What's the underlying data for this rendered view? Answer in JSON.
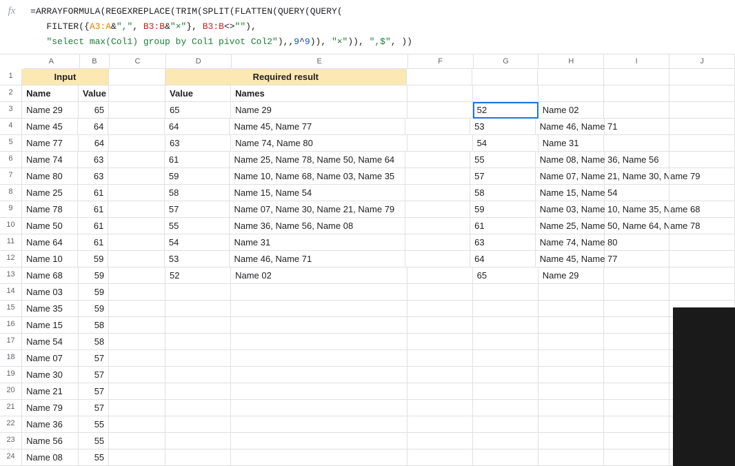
{
  "formula": {
    "line1_parts": [
      "=",
      "ARRAYFORMULA",
      "(",
      "REGEXREPLACE",
      "(",
      "TRIM",
      "(",
      "SPLIT",
      "(",
      "FLATTEN",
      "(",
      "QUERY",
      "(",
      "QUERY",
      "("
    ],
    "line2_indent": "   ",
    "line2_parts": [
      "FILTER",
      "({",
      "A3:A",
      "&",
      "\",\"",
      ", ",
      "B3:B",
      "&",
      "\"×\"",
      "}, ",
      "B3:B",
      "<>",
      "\"\"",
      "),"
    ],
    "line3_indent": "   ",
    "line3_parts": [
      "\"select max(Col1) group by Col1 pivot Col2\"",
      "),,",
      "9",
      "^",
      "9",
      ")), ",
      "\"×\"",
      ")), ",
      "\",$\"",
      ", ))"
    ]
  },
  "columns": [
    "A",
    "B",
    "C",
    "D",
    "E",
    "F",
    "G",
    "H",
    "I",
    "J"
  ],
  "headers": {
    "input_label": "Input",
    "result_label": "Required result",
    "name": "Name",
    "value": "Value",
    "names": "Names"
  },
  "input_data": [
    [
      "Name 29",
      "65"
    ],
    [
      "Name 45",
      "64"
    ],
    [
      "Name 77",
      "64"
    ],
    [
      "Name 74",
      "63"
    ],
    [
      "Name 80",
      "63"
    ],
    [
      "Name 25",
      "61"
    ],
    [
      "Name 78",
      "61"
    ],
    [
      "Name 50",
      "61"
    ],
    [
      "Name 64",
      "61"
    ],
    [
      "Name 10",
      "59"
    ],
    [
      "Name 68",
      "59"
    ],
    [
      "Name 03",
      "59"
    ],
    [
      "Name 35",
      "59"
    ],
    [
      "Name 15",
      "58"
    ],
    [
      "Name 54",
      "58"
    ],
    [
      "Name 07",
      "57"
    ],
    [
      "Name 30",
      "57"
    ],
    [
      "Name 21",
      "57"
    ],
    [
      "Name 79",
      "57"
    ],
    [
      "Name 36",
      "55"
    ],
    [
      "Name 56",
      "55"
    ],
    [
      "Name 08",
      "55"
    ]
  ],
  "required_result": [
    [
      "65",
      "Name 29"
    ],
    [
      "64",
      "Name 45, Name 77"
    ],
    [
      "63",
      "Name 74, Name 80"
    ],
    [
      "61",
      "Name 25, Name 78, Name 50, Name 64"
    ],
    [
      "59",
      "Name 10, Name 68, Name 03, Name 35"
    ],
    [
      "58",
      "Name 15, Name 54"
    ],
    [
      "57",
      "Name 07, Name 30, Name 21, Name 79"
    ],
    [
      "55",
      "Name 36, Name 56, Name 08"
    ],
    [
      "54",
      "Name 31"
    ],
    [
      "53",
      "Name 46, Name 71"
    ],
    [
      "52",
      "Name 02"
    ]
  ],
  "output_gh": [
    [
      "52",
      "Name 02"
    ],
    [
      "53",
      "Name 46, Name 71"
    ],
    [
      "54",
      "Name 31"
    ],
    [
      "55",
      "Name 08, Name 36, Name 56"
    ],
    [
      "57",
      "Name 07, Name 21, Name 30, Name 79"
    ],
    [
      "58",
      "Name 15, Name 54"
    ],
    [
      "59",
      "Name 03, Name 10, Name 35, Name 68"
    ],
    [
      "61",
      "Name 25, Name 50, Name 64, Name 78"
    ],
    [
      "63",
      "Name 74, Name 80"
    ],
    [
      "64",
      "Name 45, Name 77"
    ],
    [
      "65",
      "Name 29"
    ]
  ],
  "selected_cell_value": "52",
  "row_count": 24
}
